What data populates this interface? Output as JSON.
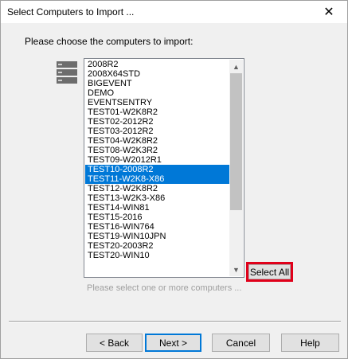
{
  "window": {
    "title": "Select Computers to Import ...",
    "close_glyph": "✕"
  },
  "prompt": "Please choose the computers to import:",
  "icon": "server-stack-icon",
  "computers": [
    {
      "label": "2008R2",
      "selected": false
    },
    {
      "label": "2008X64STD",
      "selected": false
    },
    {
      "label": "BIGEVENT",
      "selected": false
    },
    {
      "label": "DEMO",
      "selected": false
    },
    {
      "label": "EVENTSENTRY",
      "selected": false
    },
    {
      "label": "TEST01-W2K8R2",
      "selected": false
    },
    {
      "label": "TEST02-2012R2",
      "selected": false
    },
    {
      "label": "TEST03-2012R2",
      "selected": false
    },
    {
      "label": "TEST04-W2K8R2",
      "selected": false
    },
    {
      "label": "TEST08-W2K3R2",
      "selected": false
    },
    {
      "label": "TEST09-W2012R1",
      "selected": false
    },
    {
      "label": "TEST10-2008R2",
      "selected": true
    },
    {
      "label": "TEST11-W2K8-X86",
      "selected": true
    },
    {
      "label": "TEST12-W2K8R2",
      "selected": false
    },
    {
      "label": "TEST13-W2K3-X86",
      "selected": false
    },
    {
      "label": "TEST14-WIN81",
      "selected": false
    },
    {
      "label": "TEST15-2016",
      "selected": false
    },
    {
      "label": "TEST16-WIN764",
      "selected": false
    },
    {
      "label": "TEST19-WIN10JPN",
      "selected": false
    },
    {
      "label": "TEST20-2003R2",
      "selected": false
    },
    {
      "label": "TEST20-WIN10",
      "selected": false
    }
  ],
  "scrollbar": {
    "up_glyph": "▲",
    "down_glyph": "▼"
  },
  "hint": "Please select one or more computers ...",
  "buttons": {
    "select_all": "Select All",
    "back": "< Back",
    "next": "Next >",
    "cancel": "Cancel",
    "help": "Help"
  },
  "colors": {
    "selection": "#0078d7",
    "highlight_box": "#e0001a"
  }
}
